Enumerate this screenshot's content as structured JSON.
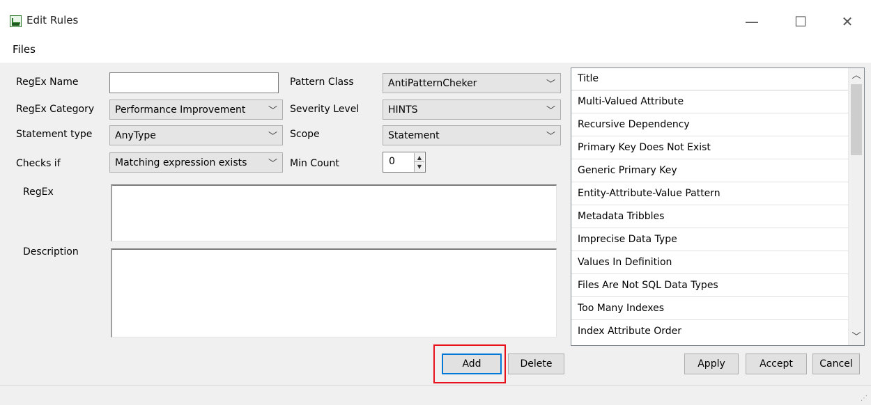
{
  "window": {
    "title": "Edit Rules",
    "minimize": "—",
    "maximize": "☐",
    "close": "✕"
  },
  "menu": {
    "files": "Files"
  },
  "form": {
    "regex_name_label": "RegEx Name",
    "regex_name_value": "",
    "regex_category_label": "RegEx Category",
    "regex_category_value": "Performance Improvement",
    "statement_type_label": "Statement type",
    "statement_type_value": "AnyType",
    "checks_if_label": "Checks if",
    "checks_if_value": "Matching expression exists",
    "pattern_class_label": "Pattern Class",
    "pattern_class_value": "AntiPatternCheker",
    "severity_level_label": "Severity Level",
    "severity_level_value": "HINTS",
    "scope_label": "Scope",
    "scope_value": "Statement",
    "min_count_label": "Min Count",
    "min_count_value": "0",
    "regex_label": "RegEx",
    "regex_value": "",
    "description_label": "Description",
    "description_value": ""
  },
  "list": {
    "header": "Title",
    "items": [
      "Multi-Valued Attribute",
      "Recursive Dependency",
      "Primary Key Does Not Exist",
      "Generic Primary Key",
      "Entity-Attribute-Value Pattern",
      "Metadata Tribbles",
      "Imprecise Data Type",
      "Values In Definition",
      "Files Are Not SQL Data Types",
      "Too Many Indexes",
      "Index Attribute Order"
    ]
  },
  "buttons": {
    "add": "Add",
    "delete": "Delete",
    "apply": "Apply",
    "accept": "Accept",
    "cancel": "Cancel"
  },
  "icons": {
    "dropdown": "chevron-down-icon",
    "app": "app-icon"
  },
  "colors": {
    "highlight": "#e8121c",
    "focus": "#0078d7"
  }
}
